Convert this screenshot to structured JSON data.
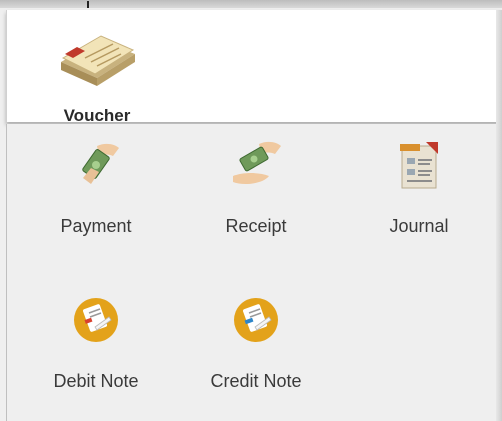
{
  "header": {
    "title": "Voucher",
    "icon": "cheque-book-icon"
  },
  "items": [
    {
      "label": "Payment",
      "icon": "payment-hand-cash-icon"
    },
    {
      "label": "Receipt",
      "icon": "receipt-hands-cash-icon"
    },
    {
      "label": "Journal",
      "icon": "journal-document-icon"
    },
    {
      "label": "Debit Note",
      "icon": "debit-note-icon"
    },
    {
      "label": "Credit Note",
      "icon": "credit-note-icon"
    }
  ],
  "colors": {
    "accent_orange": "#e3a21a",
    "cash_green": "#6f9a5a",
    "background": "#efefef"
  }
}
